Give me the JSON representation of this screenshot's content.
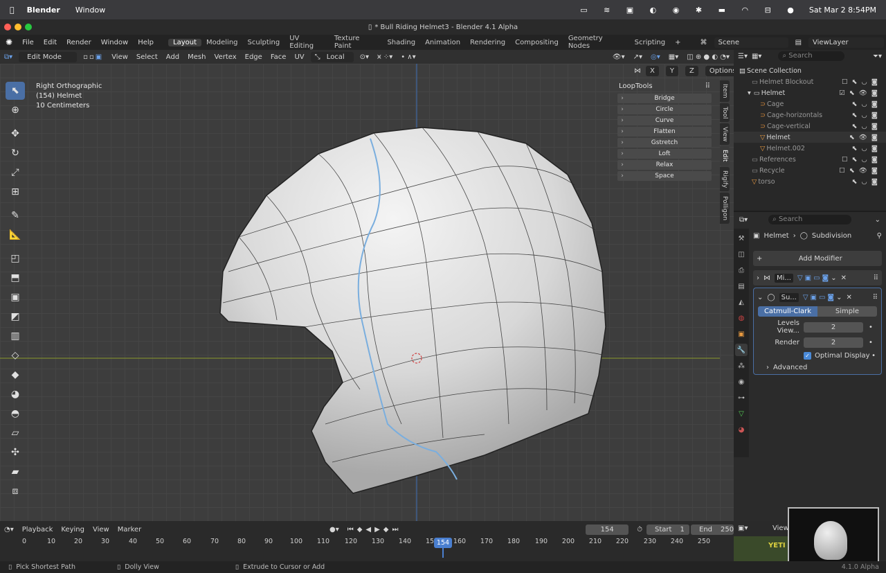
{
  "macos": {
    "apple": "",
    "app": "Blender",
    "menus": [
      "Window"
    ],
    "datetime": "Sat Mar 2  8:54PM"
  },
  "window": {
    "title": "* Bull Riding Helmet3 - Blender 4.1 Alpha"
  },
  "menu": {
    "items": [
      "File",
      "Edit",
      "Render",
      "Window",
      "Help"
    ]
  },
  "workspaces": {
    "active": "Layout",
    "tabs": [
      "Layout",
      "Modeling",
      "Sculpting",
      "UV Editing",
      "Texture Paint",
      "Shading",
      "Animation",
      "Rendering",
      "Compositing",
      "Geometry Nodes",
      "Scripting"
    ]
  },
  "scene": {
    "label": "Scene",
    "viewlayer": "ViewLayer"
  },
  "header": {
    "mode": "Edit Mode",
    "menus": [
      "View",
      "Select",
      "Add",
      "Mesh",
      "Vertex",
      "Edge",
      "Face",
      "UV"
    ],
    "orientation": "Local",
    "axes": [
      "X",
      "Y",
      "Z"
    ],
    "options": "Options"
  },
  "overlay": {
    "view": "Right Orthographic",
    "object": "(154) Helmet",
    "scale": "10 Centimeters"
  },
  "looptools": {
    "title": "LoopTools",
    "buttons": [
      "Bridge",
      "Circle",
      "Curve",
      "Flatten",
      "Gstretch",
      "Loft",
      "Relax",
      "Space"
    ]
  },
  "ntabs": [
    "Item",
    "Tool",
    "View",
    "Edit",
    "Rigify",
    "Polligon"
  ],
  "outliner": {
    "search": "Search",
    "root": "Scene Collection",
    "rows": [
      {
        "name": "Helmet Blockout",
        "indent": 1,
        "icon": "collection-icon"
      },
      {
        "name": "Helmet",
        "indent": 1,
        "icon": "collection-icon"
      },
      {
        "name": "Cage",
        "indent": 2,
        "icon": "curve-icon"
      },
      {
        "name": "Cage-horizontals",
        "indent": 2,
        "icon": "curve-icon"
      },
      {
        "name": "Cage-vertical",
        "indent": 2,
        "icon": "curve-icon"
      },
      {
        "name": "Helmet",
        "indent": 2,
        "icon": "mesh-icon"
      },
      {
        "name": "Helmet.002",
        "indent": 2,
        "icon": "mesh-icon"
      },
      {
        "name": "References",
        "indent": 1,
        "icon": "collection-icon"
      },
      {
        "name": "Recycle",
        "indent": 1,
        "icon": "collection-icon"
      },
      {
        "name": "torso",
        "indent": 1,
        "icon": "mesh-icon"
      }
    ]
  },
  "properties": {
    "search": "Search",
    "breadcrumb_object": "Helmet",
    "breadcrumb_modifier": "Subdivision",
    "add_modifier": "Add Modifier",
    "modifiers": [
      {
        "short": "Mi..."
      },
      {
        "short": "Su..."
      }
    ],
    "subdiv": {
      "tab_a": "Catmull-Clark",
      "tab_b": "Simple",
      "levels_label": "Levels View...",
      "levels": "2",
      "render_label": "Render",
      "render": "2",
      "optimal": "Optimal Display",
      "advanced": "Advanced"
    }
  },
  "timeline": {
    "menus": [
      "Playback",
      "Keying",
      "View",
      "Marker"
    ],
    "current": "154",
    "start_label": "Start",
    "start": "1",
    "end_label": "End",
    "end": "250",
    "ticks": [
      "0",
      "10",
      "20",
      "30",
      "40",
      "50",
      "60",
      "70",
      "80",
      "90",
      "100",
      "110",
      "120",
      "130",
      "140",
      "15",
      "160",
      "170",
      "180",
      "190",
      "200",
      "210",
      "220",
      "230",
      "240",
      "250"
    ]
  },
  "preview": {
    "label": "View",
    "yeti": "YETI"
  },
  "status": {
    "left": "Pick Shortest Path",
    "mid": "Dolly View",
    "right": "Extrude to Cursor or Add",
    "version": "4.1.0 Alpha"
  }
}
